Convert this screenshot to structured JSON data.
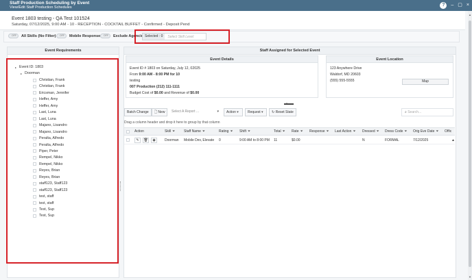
{
  "titlebar": {
    "title": "Staff Production Scheduling by Event",
    "subtitle": "View/Edit Staff Production Schedules",
    "help": "?",
    "minimize": "–",
    "restore": "▢",
    "close": "×"
  },
  "header": {
    "event": "Event 1803 testing - QA Test 101524",
    "datetime": "Saturday, 07/12/2025, 9:00 AM - 10 - RECEPTION - COCKTAIL BUFFET - Confirmed - Deposit Pend"
  },
  "filters": {
    "toggle_off": "OFF",
    "all_skills": "All Skills (No Filter)",
    "mobile_responses": "Mobile Responses",
    "exclude_agencies": "Exclude Agencies",
    "selected_label": "Selected : 0",
    "skill_placeholder": "Select Skill Level"
  },
  "left": {
    "title": "Event Requirements",
    "root": "Event ID: 1803",
    "group": "Doorman",
    "staff": [
      "Christian, Frank",
      "Christian, Frank",
      "Ericsman, Jennifer",
      "Heffer, Amy",
      "Heffer, Amy",
      "Last, Luna",
      "Last, Luna",
      "Majano, Lisandro",
      "Majano, Lisandro",
      "Peralta, Alfredo",
      "Peralta, Alfredo",
      "Piper, Peter",
      "Rempel, Nikko",
      "Rempel, Nikko",
      "Reyes, Brian",
      "Reyes, Brian",
      "staff123, Staff123",
      "staff123, Staff123",
      "test, staff",
      "test, staff",
      "Test, Sup",
      "Test, Sup"
    ]
  },
  "right": {
    "title": "Staff Assigned for Selected Event",
    "details": {
      "title": "Event Details",
      "line1": "Event ID # 1803 on Saturday, July 12, 02025",
      "from_label": "From ",
      "time": "9:00 AM - 8:00 PM",
      "for_text": " for 10",
      "line3": "testing",
      "line4": "007 Production (212) 111-1111",
      "budget_pre": "Budget Cost of ",
      "budget_cost": "$0.00",
      "budget_mid": " and Revenue of ",
      "budget_rev": "$0.00"
    },
    "location": {
      "title": "Event Location",
      "addr1": "123 Anywhere Drive",
      "addr2": "Waldorf, MD 20603",
      "phone": "(555) 555-5555",
      "map": "Map"
    }
  },
  "toolbar": {
    "batch": "Batch Change",
    "new": "New",
    "report": "Select A Report ...",
    "action": "Action",
    "request": "Request",
    "reset": "Reset State",
    "search": "Search..."
  },
  "grid": {
    "hint": "Drag a column header and drop it here to group by that column",
    "headers": [
      "Action",
      "Skill",
      "Staff Name",
      "Rating",
      "Shift",
      "Total",
      "Rate",
      "Response",
      "Last Action",
      "Dressed",
      "Dress Code",
      "Orig Eve Date",
      "Offic"
    ],
    "row": {
      "skill": "Doorman",
      "staff": "Mobile Dev, Elevate",
      "rating": "0",
      "shift": "9:00 AM to 8:00 PM",
      "total": "11",
      "rate": "$0.00",
      "dressed": "N",
      "dress_code": "FORMAL",
      "orig_date": "7/12/2025"
    }
  },
  "colors": {
    "titlebar": "#4a6f8a",
    "highlight": "#d61f26"
  }
}
